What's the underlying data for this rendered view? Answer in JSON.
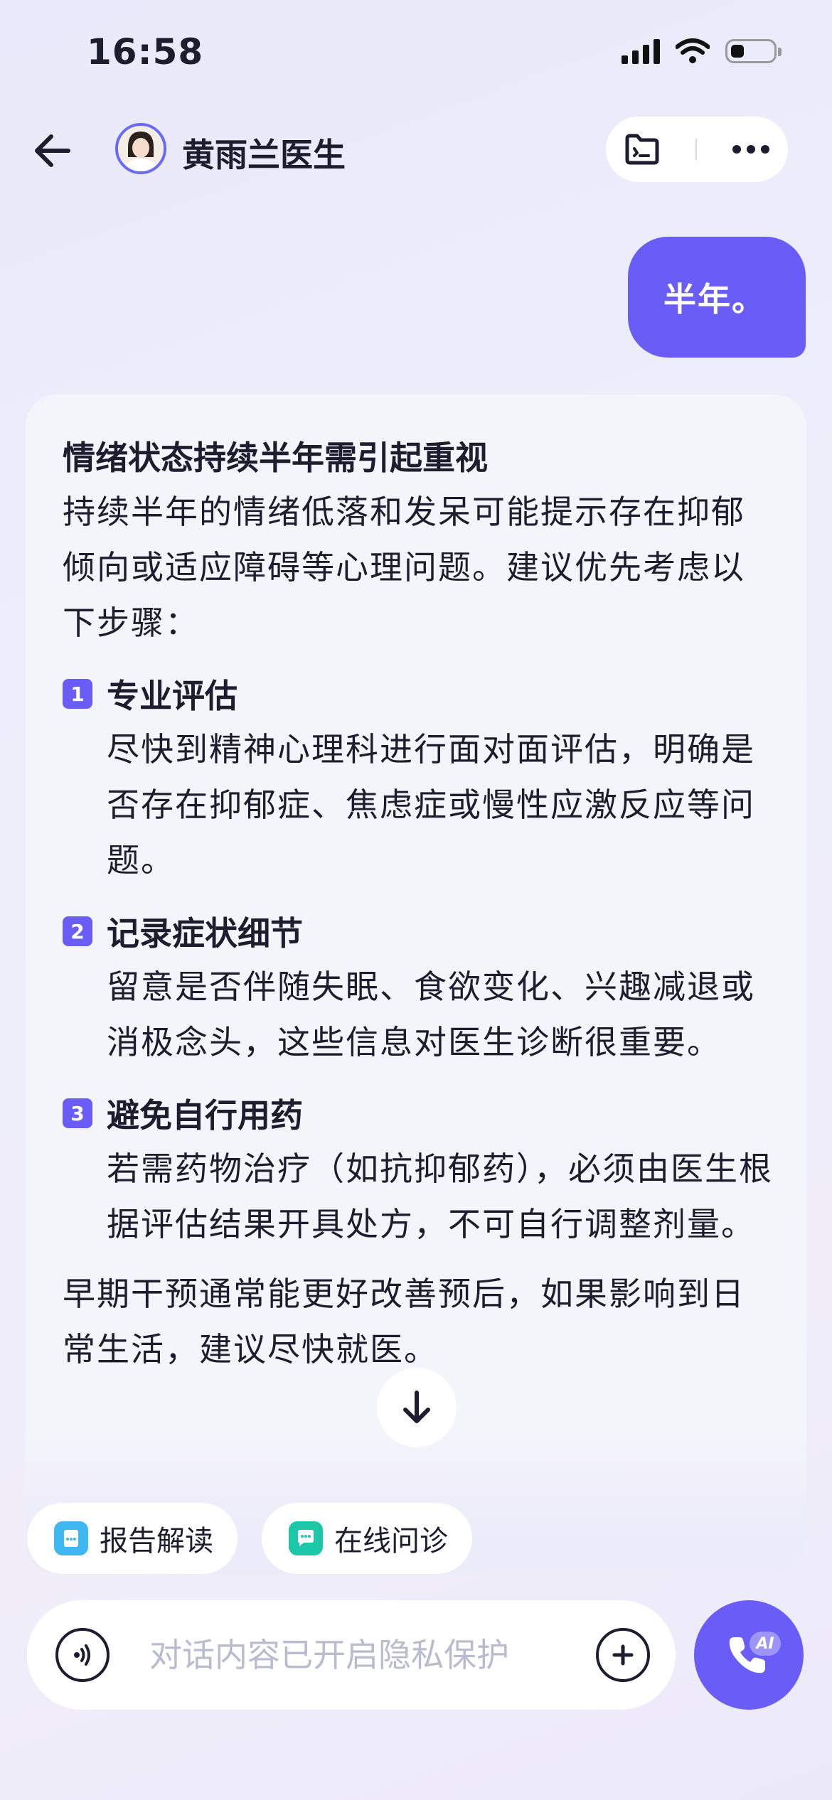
{
  "status_bar": {
    "time": "16:58"
  },
  "header": {
    "doctor_name": "黄雨兰医生"
  },
  "messages": {
    "user": "半年。",
    "reply": {
      "title": "情绪状态持续半年需引起重视",
      "intro": "持续半年的情绪低落和发呆可能提示存在抑郁倾向或适应障碍等心理问题。建议优先考虑以下步骤：",
      "steps": [
        {
          "num": "1",
          "title": "专业评估",
          "body": "尽快到精神心理科进行面对面评估，明确是否存在抑郁症、焦虑症或慢性应激反应等问题。"
        },
        {
          "num": "2",
          "title": "记录症状细节",
          "body": "留意是否伴随失眠、食欲变化、兴趣减退或消极念头，这些信息对医生诊断很重要。"
        },
        {
          "num": "3",
          "title": "避免自行用药",
          "body": "若需药物治疗（如抗抑郁药），必须由医生根据评估结果开具处方，不可自行调整剂量。"
        }
      ],
      "closing": "早期干预通常能更好改善预后，如果影响到日常生活，建议尽快就医。"
    }
  },
  "quick_actions": [
    {
      "label": "报告解读",
      "icon": "report-icon",
      "color": "#3fb8f2"
    },
    {
      "label": "在线问诊",
      "icon": "chat-icon",
      "color": "#1cc8a8"
    }
  ],
  "composer": {
    "placeholder": "对话内容已开启隐私保护",
    "value": ""
  },
  "call": {
    "badge": "AI"
  },
  "colors": {
    "accent": "#6a5cf6"
  }
}
